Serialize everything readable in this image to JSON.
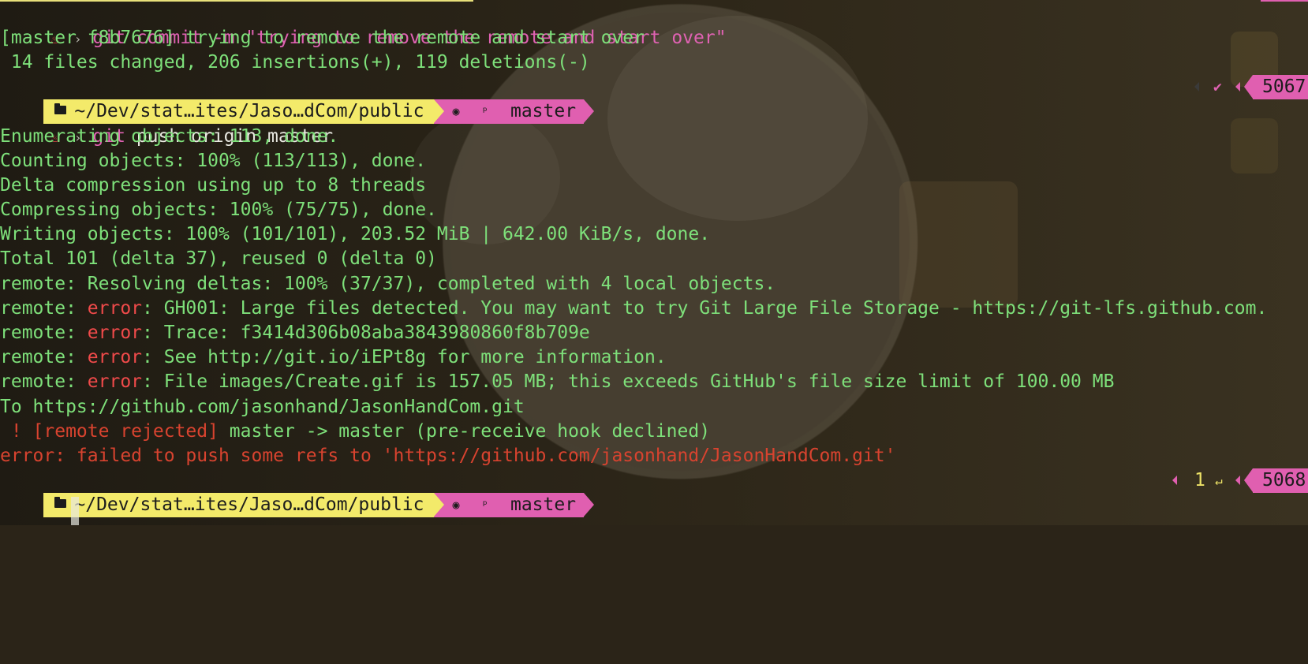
{
  "commands": {
    "commit": "git commit -m \"trying to remove the remote and start over\"",
    "push": "git push origin master"
  },
  "commit_output": [
    "[master f8b7676] trying to remove the remote and start over",
    " 14 files changed, 206 insertions(+), 119 deletions(-)"
  ],
  "prompt": {
    "path": "~/Dev/stat…ites/Jaso…dCom/public",
    "branch_glyph": "ᵖ",
    "branch": "master",
    "git_icon": "cat-git-icon",
    "prompt_glyph": "›",
    "status1": {
      "check": "✔",
      "history": "5067"
    },
    "status2": {
      "exit_code": "1",
      "return_glyph": "↵",
      "history": "5068"
    }
  },
  "push_output": [
    "Enumerating objects: 113, done.",
    "Counting objects: 100% (113/113), done.",
    "Delta compression using up to 8 threads",
    "Compressing objects: 100% (75/75), done.",
    "Writing objects: 100% (101/101), 203.52 MiB | 642.00 KiB/s, done.",
    "Total 101 (delta 37), reused 0 (delta 0)",
    "remote: Resolving deltas: 100% (37/37), completed with 4 local objects."
  ],
  "remote_prefix": "remote: ",
  "error_word": "error",
  "remote_errors": [
    ": GH001: Large files detected. You may want to try Git Large File Storage - https://git-lfs.github.com.",
    ": Trace: f3414d306b08aba3843980860f8b709e",
    ": See http://git.io/iEPt8g for more information.",
    ": File images/Create.gif is 157.05 MB; this exceeds GitHub's file size limit of 100.00 MB"
  ],
  "to_line": "To https://github.com/jasonhand/JasonHandCom.git",
  "rejected": {
    "mark": " ! ",
    "tag": "[remote rejected]",
    "rest": " master -> master (pre-receive hook declined)"
  },
  "final_error": "error: failed to push some refs to 'https://github.com/jasonhand/JasonHandCom.git'",
  "colors": {
    "output_green": "#7ee07a",
    "command_pink": "#e062b3",
    "error_red": "#f04a4a",
    "path_yellow": "#f3ea6a",
    "branch_magenta": "#e05fb0"
  }
}
